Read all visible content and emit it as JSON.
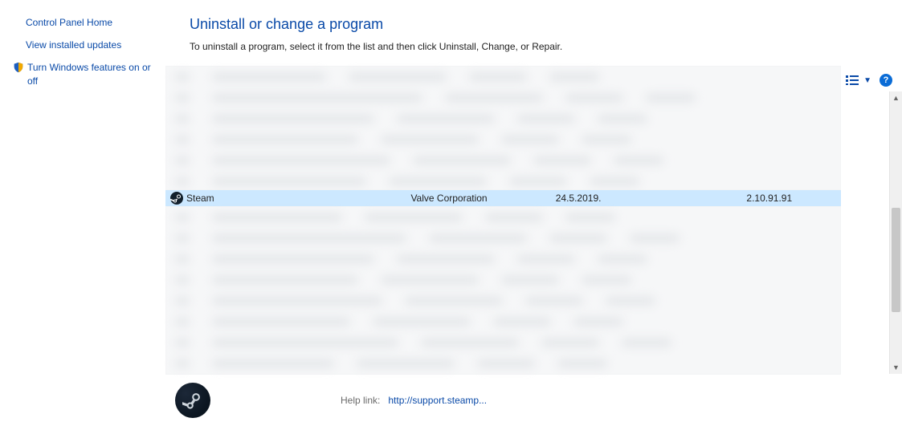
{
  "sidebar": {
    "home": "Control Panel Home",
    "updates": "View installed updates",
    "windows_features": "Turn Windows features on or off"
  },
  "main": {
    "heading": "Uninstall or change a program",
    "subheading": "To uninstall a program, select it from the list and then click Uninstall, Change, or Repair."
  },
  "program": {
    "name": "Steam",
    "publisher": "Valve Corporation",
    "installed_on": "24.5.2019.",
    "size": "",
    "version": "2.10.91.91"
  },
  "details": {
    "help_label": "Help link:",
    "help_value": "http://support.steamp..."
  }
}
